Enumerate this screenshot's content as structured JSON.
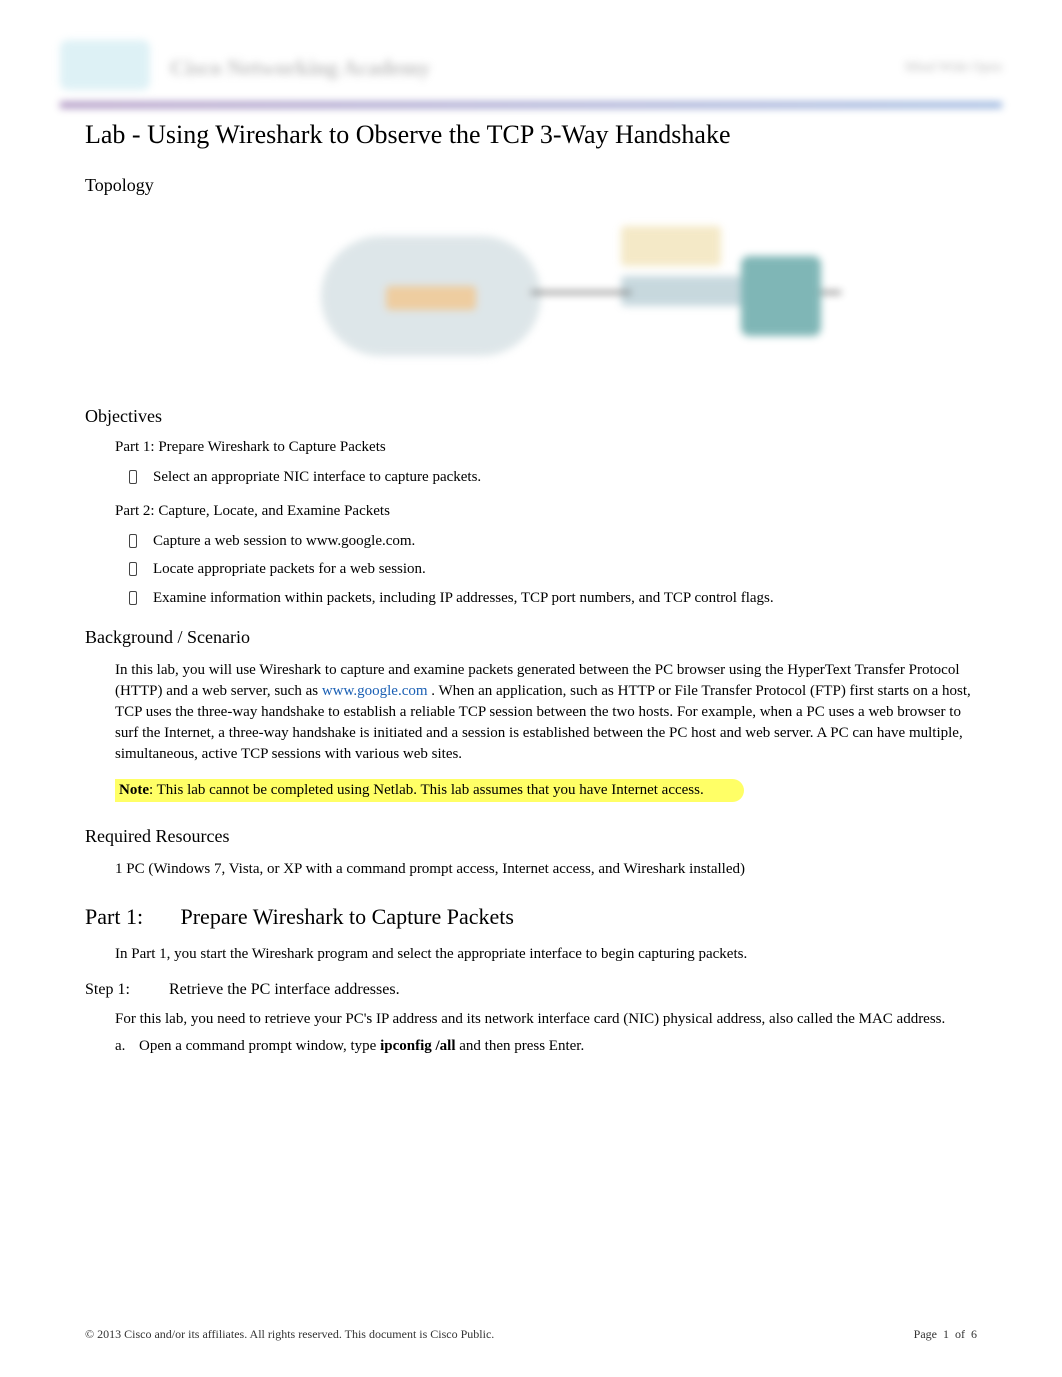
{
  "header": {
    "banner_title": "Cisco Networking Academy",
    "banner_right": "Mind Wide Open"
  },
  "doc_title": "Lab - Using Wireshark to Observe the TCP 3-Way Handshake",
  "topology": {
    "heading": "Topology"
  },
  "objectives": {
    "heading": "Objectives",
    "part1_title": "Part 1: Prepare Wireshark to Capture Packets",
    "part1_items": [
      "Select an appropriate NIC interface to capture packets."
    ],
    "part2_title": "Part 2: Capture, Locate, and Examine Packets",
    "part2_items": [
      "Capture a web session to www.google.com.",
      "Locate appropriate packets for a web session.",
      "Examine information within packets, including IP addresses, TCP port numbers, and TCP control flags."
    ]
  },
  "background": {
    "heading": "Background / Scenario",
    "para_pre": "In this lab, you will use Wireshark to capture and examine packets generated between the PC browser using the HyperText Transfer Protocol (HTTP) and a web server, such as ",
    "link_text": "www.google.com",
    "para_post": " . When an application, such as HTTP or File Transfer Protocol (FTP) first starts on a host, TCP uses the three-way handshake to establish a reliable TCP session between the two hosts. For example, when a PC uses a web browser to surf the Internet, a three-way handshake is initiated and a session is established between the PC host and web server. A PC can have multiple, simultaneous, active TCP sessions with various web sites.",
    "note_label": "Note",
    "note_text": ": This lab cannot be completed using Netlab. This lab assumes that you have Internet access."
  },
  "resources": {
    "heading": "Required Resources",
    "item": "1 PC (Windows 7, Vista, or XP with a command prompt access, Internet access, and Wireshark installed)"
  },
  "part1": {
    "num": "Part 1:",
    "title": "Prepare Wireshark to Capture Packets",
    "intro": "In Part 1, you start the Wireshark program and select the appropriate interface to begin capturing packets."
  },
  "step1": {
    "num": "Step 1:",
    "title": "Retrieve the PC interface addresses.",
    "intro": "For this lab, you need to retrieve your PC's IP address and its network interface card (NIC) physical address, also called the MAC address.",
    "item_a_letter": "a.",
    "item_a_pre": "Open a command prompt window, type ",
    "item_a_cmd": "ipconfig /all",
    "item_a_post": " and then press Enter."
  },
  "footer": {
    "copyright": "© 2013 Cisco and/or its affiliates. All rights reserved. This document is Cisco Public.",
    "page_label": "Page",
    "page_current": "1",
    "page_of": "of",
    "page_total": "6"
  }
}
